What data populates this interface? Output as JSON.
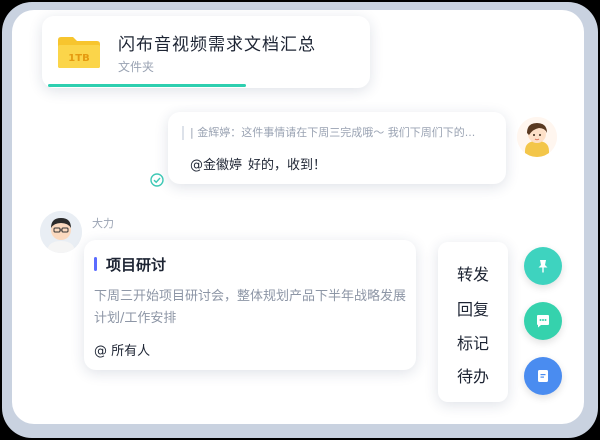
{
  "file": {
    "title": "闪布音视频需求文档汇总",
    "subtitle": "文件夹",
    "icon": "folder-icon",
    "icon_label": "1TB",
    "accent": "#2ecfb0"
  },
  "message": {
    "quote": "| 金辉婷：这件事情请在下周三完成哦～ 我们下周们下的...",
    "mention": "@金徽婷",
    "reply": "好的，收到！",
    "status_icon": "read-receipt-icon"
  },
  "task": {
    "sender": "大力",
    "title": "项目研讨",
    "description": "下周三开始项目研讨会，整体规划产品下半年战略发展计划/工作安排",
    "mention_all": "@ 所有人"
  },
  "context_menu": {
    "items": [
      "转发",
      "回复",
      "标记",
      "待办"
    ]
  },
  "actions": {
    "pin": {
      "icon": "pin-icon",
      "color": "#3ed3bf"
    },
    "comment": {
      "icon": "comment-icon",
      "color": "#35d2ad"
    },
    "bookmark": {
      "icon": "bookmark-icon",
      "color": "#4a8cf0"
    }
  }
}
